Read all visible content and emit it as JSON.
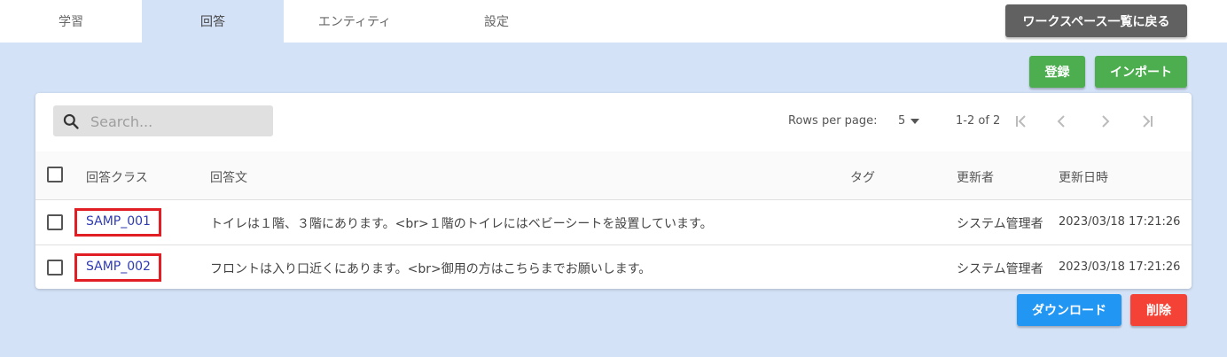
{
  "nav": {
    "tabs": [
      "学習",
      "回答",
      "エンティティ",
      "設定"
    ],
    "back_label": "ワークスペース一覧に戻る"
  },
  "actions": {
    "register_label": "登録",
    "import_label": "インポート",
    "download_label": "ダウンロード",
    "delete_label": "削除"
  },
  "table": {
    "search_placeholder": "Search...",
    "rows_per_page_label": "Rows per page:",
    "rows_per_page_value": "5",
    "range_label": "1-2 of 2",
    "headers": {
      "class": "回答クラス",
      "text": "回答文",
      "tag": "タグ",
      "updater": "更新者",
      "updated_at": "更新日時"
    },
    "rows": [
      {
        "class": "SAMP_001",
        "text": "トイレは１階、３階にあります。<br>１階のトイレにはベビーシートを設置しています。",
        "tag": "",
        "updater": "システム管理者",
        "updated_at": "2023/03/18 17:21:26"
      },
      {
        "class": "SAMP_002",
        "text": "フロントは入り口近くにあります。<br>御用の方はこちらまでお願いします。",
        "tag": "",
        "updater": "システム管理者",
        "updated_at": "2023/03/18 17:21:26"
      }
    ]
  },
  "colors": {
    "background": "#d4e2f7",
    "green": "#4cae4f",
    "blue": "#2196f3",
    "red": "#f44336",
    "highlight": "#e01e24"
  }
}
